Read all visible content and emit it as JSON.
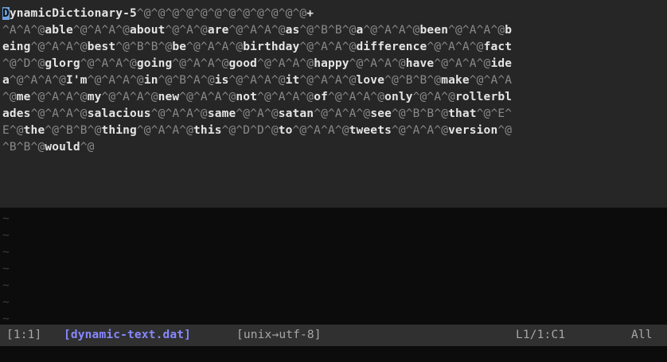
{
  "editor": {
    "buffer_lines": [
      [
        [
          "cursor",
          "D"
        ],
        [
          "t",
          "ynamicDictionary-5"
        ],
        [
          "c",
          "^@^@^@^@^@^@^@^@^@^@^@^@"
        ],
        [
          "t",
          "+"
        ]
      ],
      [
        [
          "c",
          "^A^A^@"
        ],
        [
          "t",
          "able"
        ],
        [
          "c",
          "^@^A^A^@"
        ],
        [
          "t",
          "about"
        ],
        [
          "c",
          "^@^A^@"
        ],
        [
          "t",
          "are"
        ],
        [
          "c",
          "^@^A^A^@"
        ],
        [
          "t",
          "as"
        ],
        [
          "c",
          "^@^B^B^@"
        ],
        [
          "t",
          "a"
        ],
        [
          "c",
          "^@^A^A^@"
        ],
        [
          "t",
          "been"
        ],
        [
          "c",
          "^@^A^A^@"
        ],
        [
          "t",
          "b"
        ]
      ],
      [
        [
          "t",
          "eing"
        ],
        [
          "c",
          "^@^A^A^@"
        ],
        [
          "t",
          "best"
        ],
        [
          "c",
          "^@^B^B^@"
        ],
        [
          "t",
          "be"
        ],
        [
          "c",
          "^@^A^A^@"
        ],
        [
          "t",
          "birthday"
        ],
        [
          "c",
          "^@^A^A^@"
        ],
        [
          "t",
          "difference"
        ],
        [
          "c",
          "^@^A^A^@"
        ],
        [
          "t",
          "fact"
        ]
      ],
      [
        [
          "c",
          "^@^D^@"
        ],
        [
          "t",
          "glorg"
        ],
        [
          "c",
          "^@^A^A^@"
        ],
        [
          "t",
          "going"
        ],
        [
          "c",
          "^@^A^A^@"
        ],
        [
          "t",
          "good"
        ],
        [
          "c",
          "^@^A^A^@"
        ],
        [
          "t",
          "happy"
        ],
        [
          "c",
          "^@^A^A^@"
        ],
        [
          "t",
          "have"
        ],
        [
          "c",
          "^@^A^A^@"
        ],
        [
          "t",
          "ide"
        ]
      ],
      [
        [
          "t",
          "a"
        ],
        [
          "c",
          "^@^A^A^@"
        ],
        [
          "t",
          "I'm"
        ],
        [
          "c",
          "^@^A^A^@"
        ],
        [
          "t",
          "in"
        ],
        [
          "c",
          "^@^B^A^@"
        ],
        [
          "t",
          "is"
        ],
        [
          "c",
          "^@^A^A^@"
        ],
        [
          "t",
          "it"
        ],
        [
          "c",
          "^@^A^A^@"
        ],
        [
          "t",
          "love"
        ],
        [
          "c",
          "^@^B^B^@"
        ],
        [
          "t",
          "make"
        ],
        [
          "c",
          "^@^A^A"
        ]
      ],
      [
        [
          "c",
          "^@"
        ],
        [
          "t",
          "me"
        ],
        [
          "c",
          "^@^A^A^@"
        ],
        [
          "t",
          "my"
        ],
        [
          "c",
          "^@^A^A^@"
        ],
        [
          "t",
          "new"
        ],
        [
          "c",
          "^@^A^A^@"
        ],
        [
          "t",
          "not"
        ],
        [
          "c",
          "^@^A^A^@"
        ],
        [
          "t",
          "of"
        ],
        [
          "c",
          "^@^A^A^@"
        ],
        [
          "t",
          "only"
        ],
        [
          "c",
          "^@^A^@"
        ],
        [
          "t",
          "rollerbl"
        ]
      ],
      [
        [
          "t",
          "ades"
        ],
        [
          "c",
          "^@^A^A^@"
        ],
        [
          "t",
          "salacious"
        ],
        [
          "c",
          "^@^A^A^@"
        ],
        [
          "t",
          "same"
        ],
        [
          "c",
          "^@^A^@"
        ],
        [
          "t",
          "satan"
        ],
        [
          "c",
          "^@^A^A^@"
        ],
        [
          "t",
          "see"
        ],
        [
          "c",
          "^@^B^B^@"
        ],
        [
          "t",
          "that"
        ],
        [
          "c",
          "^@^E^"
        ]
      ],
      [
        [
          "c",
          "E^@"
        ],
        [
          "t",
          "the"
        ],
        [
          "c",
          "^@^B^B^@"
        ],
        [
          "t",
          "thing"
        ],
        [
          "c",
          "^@^A^A^@"
        ],
        [
          "t",
          "this"
        ],
        [
          "c",
          "^@^D^D^@"
        ],
        [
          "t",
          "to"
        ],
        [
          "c",
          "^@^A^A^@"
        ],
        [
          "t",
          "tweets"
        ],
        [
          "c",
          "^@^A^A^@"
        ],
        [
          "t",
          "version"
        ],
        [
          "c",
          "^@"
        ]
      ],
      [
        [
          "c",
          "^B^B^@"
        ],
        [
          "t",
          "would"
        ],
        [
          "c",
          "^@"
        ]
      ]
    ],
    "empty_line_marker": "~",
    "empty_line_count": 7
  },
  "statusline": {
    "position": "[1:1]",
    "filename": "[dynamic-text.dat]",
    "format": "[unix→utf-8]",
    "line_col": "L1/1:C1",
    "scroll": "All"
  },
  "colors": {
    "text": "#e4e4e4",
    "control_chars": "#8a8a8a",
    "cursor": "#6fa3e0",
    "filename": "#8787ff",
    "buffer_bg": "#262626",
    "status_bg": "#303030"
  }
}
